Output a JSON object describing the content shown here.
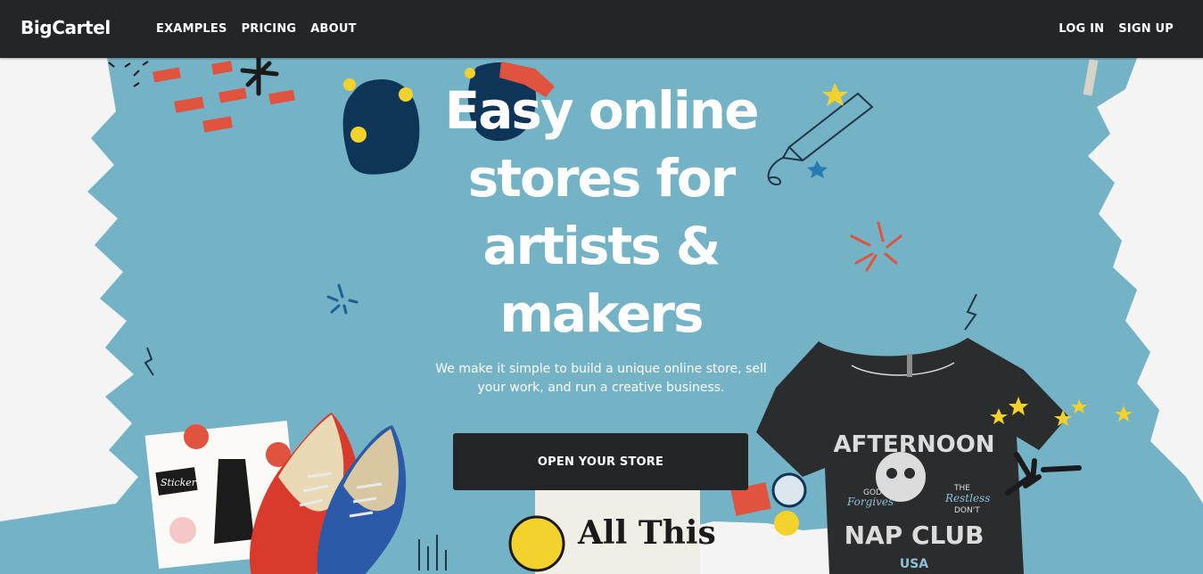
{
  "header": {
    "brand": "BigCartel",
    "nav_left": [
      "EXAMPLES",
      "PRICING",
      "ABOUT"
    ],
    "nav_right": [
      "LOG IN",
      "SIGN UP"
    ]
  },
  "hero": {
    "title": "Easy online stores for artists & makers",
    "subtitle": "We make it simple to build a unique online store, sell your work, and run a creative business.",
    "cta_label": "OPEN YOUR STORE"
  },
  "art": {
    "tshirt_line1": "AFTERNOON",
    "tshirt_line2": "NAP CLUB",
    "tshirt_small_left": "GOD",
    "tshirt_small_left2": "Forgives",
    "tshirt_small_right": "THE",
    "tshirt_small_right2": "Restless",
    "tshirt_small_right3": "DON'T",
    "tshirt_usa": "USA",
    "print_text": "All This",
    "sticker_text": "Sticker"
  },
  "colors": {
    "header_bg": "#232527",
    "paint_blue": "#74b3c6",
    "page_bg": "#f4f4f4",
    "cta_bg": "#232527",
    "accent_red": "#e0533f",
    "accent_yellow": "#f3d22d",
    "navy": "#0e3557"
  }
}
